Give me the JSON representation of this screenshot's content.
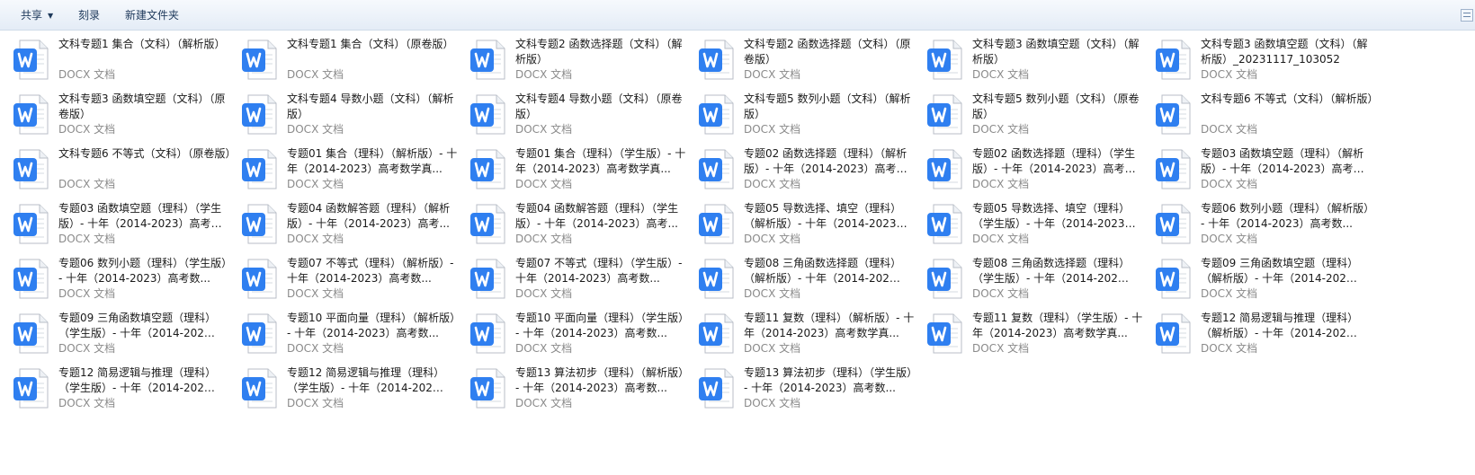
{
  "toolbar": {
    "share_label": "共享",
    "burn_label": "刻录",
    "new_folder_label": "新建文件夹"
  },
  "file_icon": "wps-writer-document-icon",
  "file_type_label": "DOCX 文档",
  "files": [
    {
      "name": "文科专题1 集合（文科）（解析版）"
    },
    {
      "name": "文科专题1 集合（文科）（原卷版）"
    },
    {
      "name": "文科专题2 函数选择题（文科）（解析版）"
    },
    {
      "name": "文科专题2 函数选择题（文科）（原卷版）"
    },
    {
      "name": "文科专题3 函数填空题（文科）（解析版）"
    },
    {
      "name": "文科专题3 函数填空题（文科）（解析版）_20231117_103052"
    },
    {
      "name": "文科专题3 函数填空题（文科）（原卷版）"
    },
    {
      "name": "文科专题4 导数小题（文科）（解析版）"
    },
    {
      "name": "文科专题4 导数小题（文科）（原卷版）"
    },
    {
      "name": "文科专题5 数列小题（文科）（解析版）"
    },
    {
      "name": "文科专题5 数列小题（文科）（原卷版）"
    },
    {
      "name": "文科专题6 不等式（文科）（解析版）"
    },
    {
      "name": "文科专题6 不等式（文科）（原卷版）"
    },
    {
      "name": "专题01 集合（理科）（解析版）- 十年（2014-2023）高考数学真..."
    },
    {
      "name": "专题01 集合（理科）（学生版）- 十年（2014-2023）高考数学真..."
    },
    {
      "name": "专题02 函数选择题（理科）（解析版）- 十年（2014-2023）高考数..."
    },
    {
      "name": "专题02 函数选择题（理科）（学生版）- 十年（2014-2023）高考数..."
    },
    {
      "name": "专题03 函数填空题（理科）（解析版）- 十年（2014-2023）高考数..."
    },
    {
      "name": "专题03 函数填空题（理科）（学生版）- 十年（2014-2023）高考数..."
    },
    {
      "name": "专题04 函数解答题（理科）（解析版）- 十年（2014-2023）高考..."
    },
    {
      "name": "专题04 函数解答题（理科）（学生版）- 十年（2014-2023）高考..."
    },
    {
      "name": "专题05 导数选择、填空（理科）（解析版）- 十年（2014-2023）高..."
    },
    {
      "name": "专题05 导数选择、填空（理科）（学生版）- 十年（2014-2023）高..."
    },
    {
      "name": "专题06 数列小题（理科）（解析版）- 十年（2014-2023）高考数..."
    },
    {
      "name": "专题06 数列小题（理科）（学生版）- 十年（2014-2023）高考数..."
    },
    {
      "name": "专题07 不等式（理科）（解析版）- 十年（2014-2023）高考数..."
    },
    {
      "name": "专题07 不等式（理科）（学生版）- 十年（2014-2023）高考数..."
    },
    {
      "name": "专题08 三角函数选择题（理科）（解析版）- 十年（2014-2023）..."
    },
    {
      "name": "专题08 三角函数选择题（理科）（学生版）- 十年（2014-2023）..."
    },
    {
      "name": "专题09 三角函数填空题（理科）（解析版）- 十年（2014-2023）..."
    },
    {
      "name": "专题09 三角函数填空题（理科）（学生版）- 十年（2014-2023）..."
    },
    {
      "name": "专题10 平面向量（理科）（解析版）- 十年（2014-2023）高考数..."
    },
    {
      "name": "专题10 平面向量（理科）（学生版）- 十年（2014-2023）高考数..."
    },
    {
      "name": "专题11 复数（理科）（解析版）- 十年（2014-2023）高考数学真..."
    },
    {
      "name": "专题11 复数（理科）（学生版）- 十年（2014-2023）高考数学真..."
    },
    {
      "name": "专题12 简易逻辑与推理（理科）（解析版）- 十年（2014-2023）..."
    },
    {
      "name": "专题12 简易逻辑与推理（理科）（学生版）- 十年（2014-2023）..."
    },
    {
      "name": "专题12 简易逻辑与推理（理科）（学生版）- 十年（2014-2023）..."
    },
    {
      "name": "专题13 算法初步（理科）（解析版）- 十年（2014-2023）高考数..."
    },
    {
      "name": "专题13 算法初步（理科）（学生版）- 十年（2014-2023）高考数..."
    }
  ]
}
